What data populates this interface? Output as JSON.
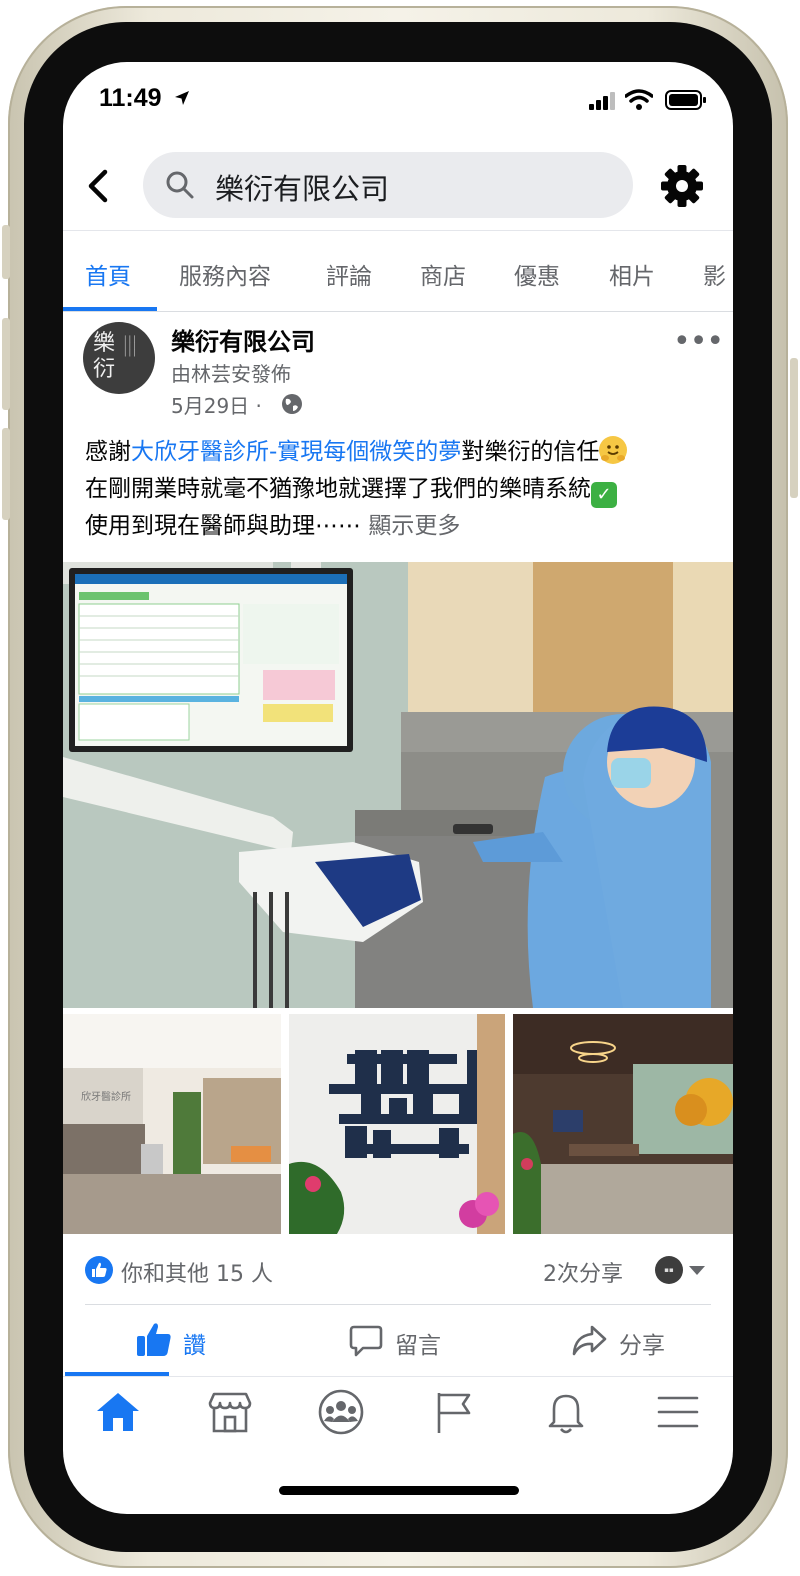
{
  "status": {
    "time": "11:49"
  },
  "search": {
    "query": "樂衍有限公司"
  },
  "tabs": [
    {
      "label": "首頁",
      "active": true
    },
    {
      "label": "服務內容"
    },
    {
      "label": "評論"
    },
    {
      "label": "商店"
    },
    {
      "label": "優惠"
    },
    {
      "label": "相片"
    },
    {
      "label": "影"
    }
  ],
  "post": {
    "author": "樂衍有限公司",
    "posted_by": "由林芸安發佈",
    "date": "5月29日",
    "avatar_text": "樂衍",
    "text_line1_pre": "感謝",
    "text_line1_link": "大欣牙醫診所-實現每個微笑的夢",
    "text_line1_post": "對樂衍的信任",
    "text_line2": "在剛開業時就毫不猶豫地就選擇了我們的樂晴系統",
    "text_line3": "使用到現在醫師與助理⋯⋯ ",
    "see_more": "顯示更多",
    "photo_sign_text": "欣牙醫診所",
    "reactions_text": "你和其他 15 人",
    "share_count": "2次分享"
  },
  "actions": {
    "like": "讚",
    "comment": "留言",
    "share": "分享"
  },
  "colors": {
    "accent": "#1877f2",
    "secondary_text": "#65676b"
  },
  "icons": [
    "back-chevron-icon",
    "search-icon",
    "gear-icon",
    "globe-icon",
    "more-icon",
    "like-icon",
    "comment-icon",
    "share-icon",
    "home-icon",
    "marketplace-icon",
    "groups-icon",
    "pages-flag-icon",
    "bell-icon",
    "menu-icon"
  ]
}
